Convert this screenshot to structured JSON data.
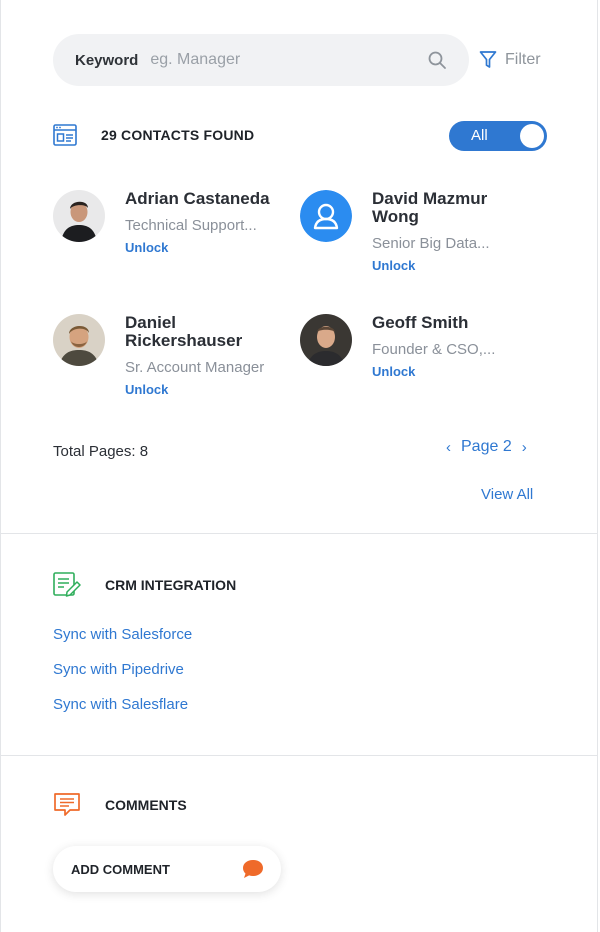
{
  "search": {
    "keyword_label": "Keyword",
    "placeholder": "eg. Manager",
    "value": "",
    "search_icon": "search-icon",
    "filter_label": "Filter",
    "filter_icon": "filter-icon"
  },
  "contacts": {
    "header_icon": "contacts-card-icon",
    "found_label": "29 CONTACTS FOUND",
    "toggle_label": "All",
    "toggle_on": true,
    "items": [
      {
        "name": "Adrian Castaneda",
        "role": "Technical Support...",
        "action": "Unlock"
      },
      {
        "name": "David Mazmur Wong",
        "role": "Senior Big Data...",
        "action": "Unlock"
      },
      {
        "name": "Daniel Rickershauser",
        "role": "Sr. Account Manager",
        "action": "Unlock"
      },
      {
        "name": "Geoff Smith",
        "role": "Founder & CSO,...",
        "action": "Unlock"
      }
    ],
    "total_pages_label": "Total Pages: 8",
    "page_label": "Page 2",
    "view_all_label": "View All"
  },
  "crm": {
    "icon": "crm-edit-icon",
    "title": "CRM INTEGRATION",
    "links": [
      "Sync with Salesforce",
      "Sync with Pipedrive",
      "Sync with Salesflare"
    ]
  },
  "comments": {
    "icon": "comment-icon",
    "title": "COMMENTS",
    "add_label": "ADD COMMENT"
  },
  "colors": {
    "accent": "#2f78d1",
    "crm_icon": "#2fae5b",
    "comment_icon": "#ef6a2a"
  }
}
